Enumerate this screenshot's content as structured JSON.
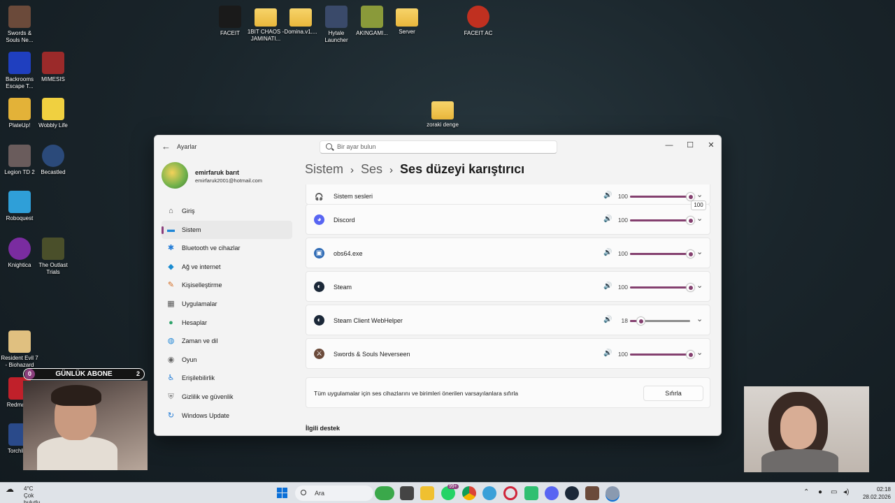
{
  "desktop": {
    "icons": [
      {
        "label": "Swords & Souls Ne..."
      },
      {
        "label": "Backrooms Escape T..."
      },
      {
        "label": "MIMESIS"
      },
      {
        "label": "PlateUp!"
      },
      {
        "label": "Wobbly Life"
      },
      {
        "label": "Legion TD 2"
      },
      {
        "label": "Becastled"
      },
      {
        "label": "Roboquest"
      },
      {
        "label": "Knightica"
      },
      {
        "label": "The Outlast Trials"
      },
      {
        "label": "Resident Evil 7 - Biohazard"
      },
      {
        "label": "Redmatch"
      },
      {
        "label": "Torchlig..."
      },
      {
        "label": "FACEIT"
      },
      {
        "label": "1BIT CHAOS - JAMINATI..."
      },
      {
        "label": "Domina.v1...."
      },
      {
        "label": "Hytale Launcher"
      },
      {
        "label": "AKINGAMI..."
      },
      {
        "label": "Server"
      },
      {
        "label": "FACEIT AC"
      },
      {
        "label": "zoraki denge"
      }
    ]
  },
  "window": {
    "app_title": "Ayarlar",
    "search_placeholder": "Bir ayar bulun",
    "controls": {
      "minimize": "—",
      "maximize": "☐",
      "close": "✕"
    }
  },
  "profile": {
    "name": "emirfaruk barıt",
    "email": "emirfaruk2001@hotmail.com"
  },
  "nav": [
    {
      "label": "Giriş",
      "icon": "home-icon",
      "glyph": "⌂",
      "color": "#555"
    },
    {
      "label": "Sistem",
      "icon": "system-icon",
      "glyph": "▬",
      "color": "#1f86d6",
      "active": true
    },
    {
      "label": "Bluetooth ve cihazlar",
      "icon": "bluetooth-icon",
      "glyph": "✱",
      "color": "#1f7ad6"
    },
    {
      "label": "Ağ ve internet",
      "icon": "wifi-icon",
      "glyph": "◆",
      "color": "#1a8bd0"
    },
    {
      "label": "Kişiselleştirme",
      "icon": "brush-icon",
      "glyph": "✎",
      "color": "#d2691e"
    },
    {
      "label": "Uygulamalar",
      "icon": "apps-icon",
      "glyph": "▦",
      "color": "#555"
    },
    {
      "label": "Hesaplar",
      "icon": "account-icon",
      "glyph": "●",
      "color": "#2fa36b"
    },
    {
      "label": "Zaman ve dil",
      "icon": "globe-icon",
      "glyph": "◍",
      "color": "#1f86d6"
    },
    {
      "label": "Oyun",
      "icon": "gamepad-icon",
      "glyph": "◉",
      "color": "#666"
    },
    {
      "label": "Erişilebilirlik",
      "icon": "accessibility-icon",
      "glyph": "♿",
      "color": "#1f7ad6"
    },
    {
      "label": "Gizlilik ve güvenlik",
      "icon": "shield-icon",
      "glyph": "⛨",
      "color": "#777"
    },
    {
      "label": "Windows Update",
      "icon": "update-icon",
      "glyph": "↻",
      "color": "#1f7ad6"
    }
  ],
  "breadcrumb": {
    "part1": "Sistem",
    "sep": "›",
    "part2": "Ses",
    "current": "Ses düzeyi karıştırıcı"
  },
  "mixer": [
    {
      "name": "Sistem sesleri",
      "icon": "headphones-icon",
      "glyph": "🎧",
      "bg": "transparent",
      "volume": "100",
      "level": 1.0,
      "tooltip": "100"
    },
    {
      "name": "Discord",
      "icon": "discord-icon",
      "glyph": "◕",
      "bg": "#5865f2",
      "volume": "100",
      "level": 1.0
    },
    {
      "name": "obs64.exe",
      "icon": "obs-icon",
      "glyph": "▣",
      "bg": "#2f6bb5",
      "volume": "100",
      "level": 1.0
    },
    {
      "name": "Steam",
      "icon": "steam-icon",
      "glyph": "◐",
      "bg": "#1b2838",
      "volume": "100",
      "level": 1.0
    },
    {
      "name": "Steam Client WebHelper",
      "icon": "steam-icon",
      "glyph": "◐",
      "bg": "#1b2838",
      "volume": "18",
      "level": 0.18
    },
    {
      "name": "Swords & Souls Neverseen",
      "icon": "game-icon",
      "glyph": "⚔",
      "bg": "#6b4a3a",
      "volume": "100",
      "level": 1.0
    }
  ],
  "reset": {
    "text": "Tüm uygulamalar için ses cihazlarını ve birimleri önerilen varsayılanlara sıfırla",
    "button": "Sıfırla"
  },
  "related": "İlgili destek",
  "overlay": {
    "label": "GÜNLÜK ABONE",
    "left_count": "0",
    "right_count": "2"
  },
  "taskbar": {
    "temp": "4°C",
    "weather": "Çok bulutlu",
    "search": "Ara",
    "badge": "99+",
    "time": "02:18",
    "date": "28.02.2026"
  },
  "colors": {
    "accent": "#84406f"
  }
}
